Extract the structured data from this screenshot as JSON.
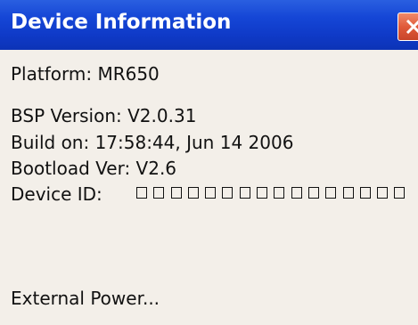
{
  "window": {
    "title": "Device Information",
    "close_icon": "close-icon"
  },
  "info": {
    "platform": "Platform: MR650",
    "bsp_version": "BSP Version: V2.0.31",
    "build_on": "Build on: 17:58:44, Jun 14 2006",
    "bootload_ver": "Bootload Ver: V2.6",
    "device_id_label": "Device ID:",
    "device_id_glyph_count": 16
  },
  "external_power": "External Power..."
}
